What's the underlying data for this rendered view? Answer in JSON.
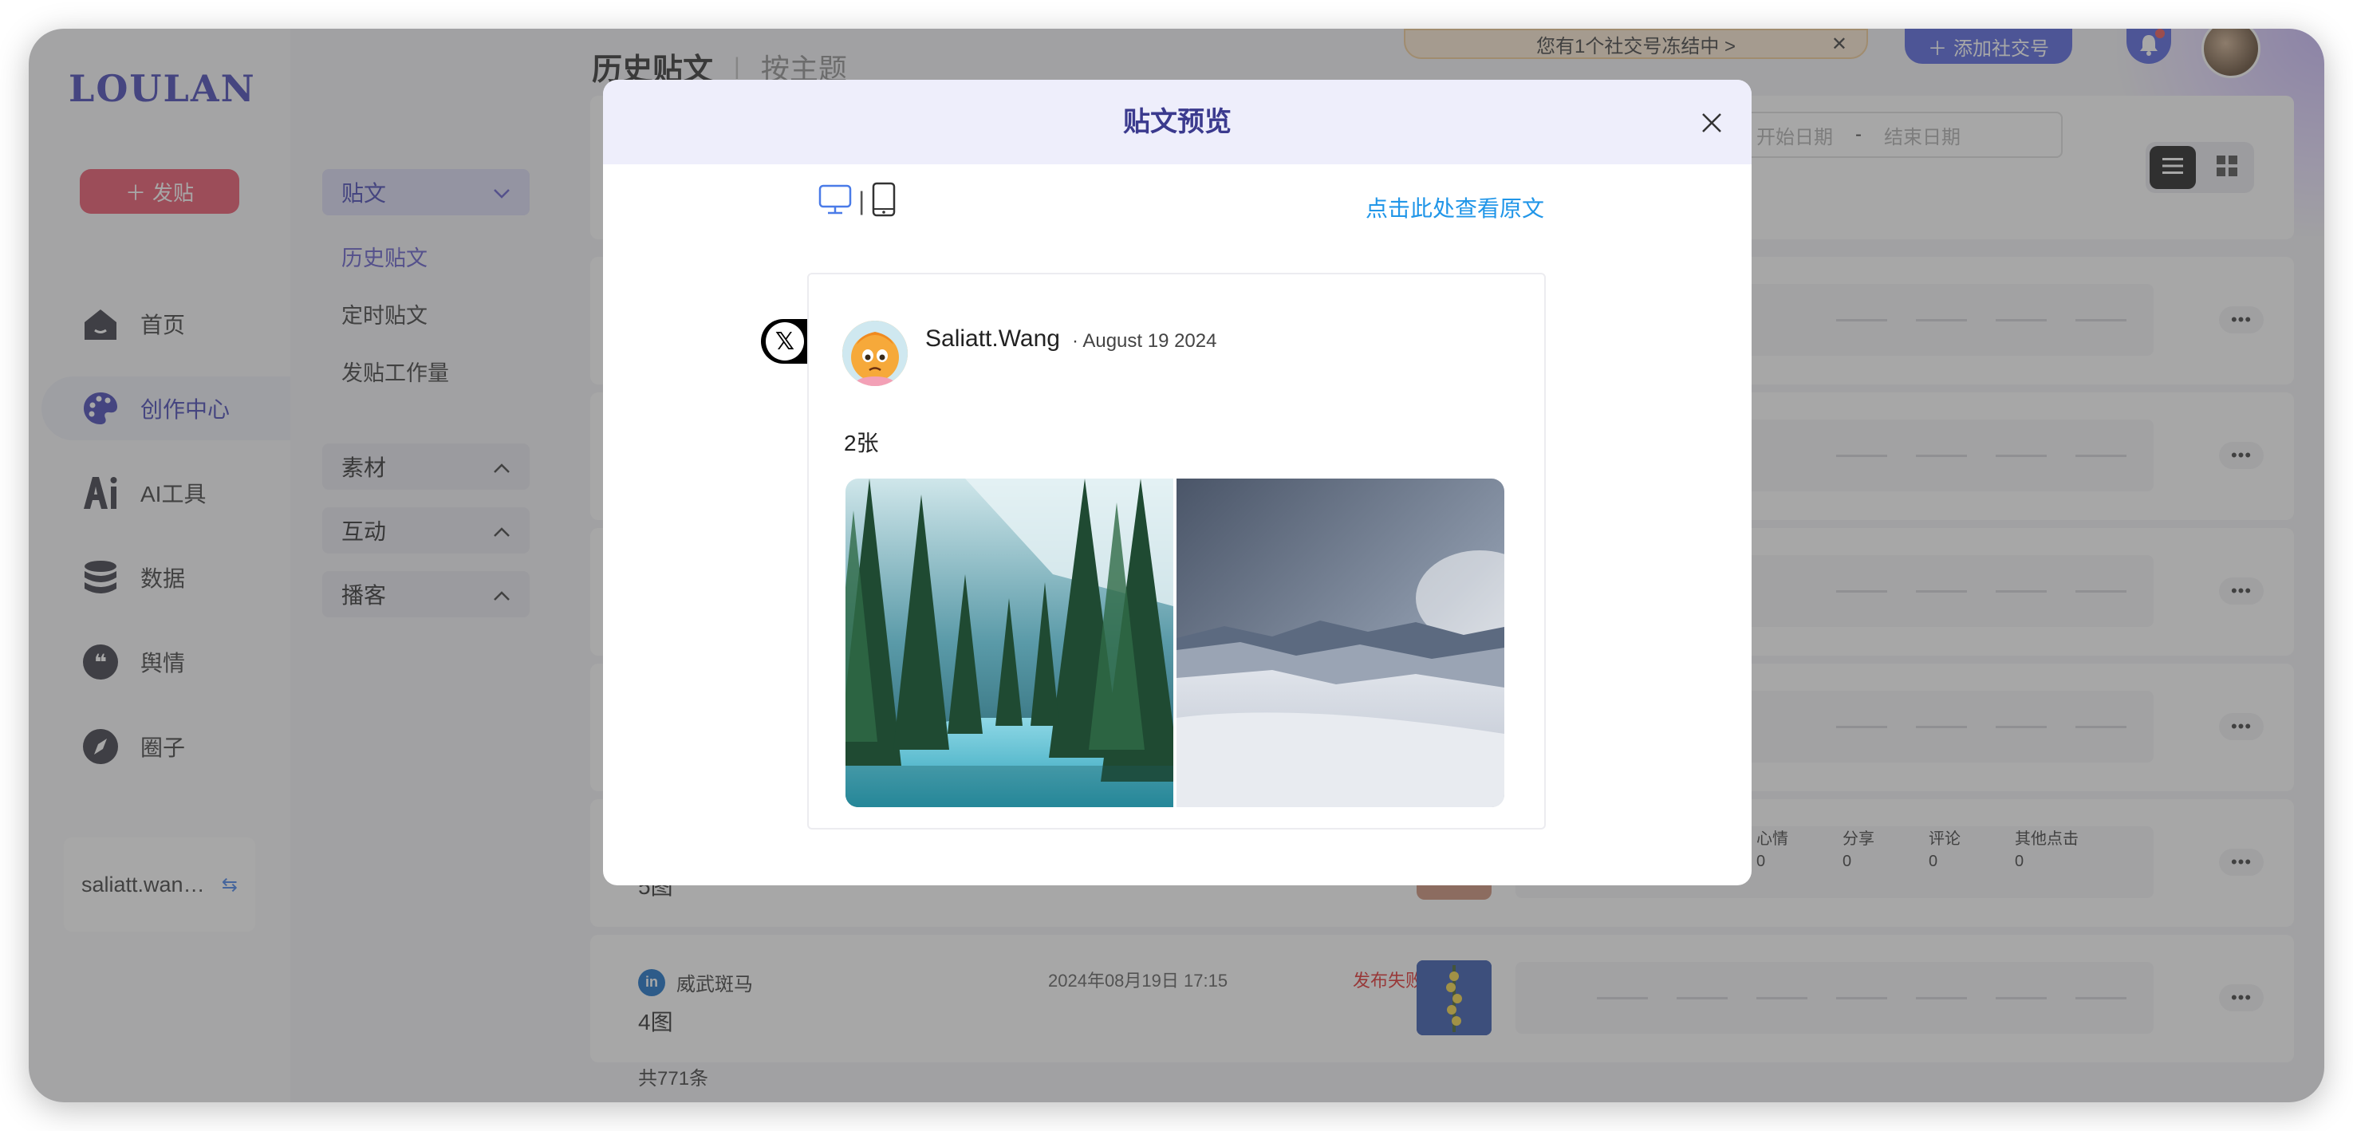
{
  "app": {
    "logo": "LOULAN",
    "publish_label": "发贴"
  },
  "nav": [
    {
      "label": "首页",
      "icon": "home-icon"
    },
    {
      "label": "创作中心",
      "icon": "palette-icon",
      "active": true
    },
    {
      "label": "AI工具",
      "icon": "ai-icon"
    },
    {
      "label": "数据",
      "icon": "database-icon"
    },
    {
      "label": "舆情",
      "icon": "quote-icon"
    },
    {
      "label": "圈子",
      "icon": "compass-icon"
    }
  ],
  "account": {
    "name": "saliatt.wan…",
    "switch_icon": "switch-icon"
  },
  "submenu": {
    "post_header": "贴文",
    "post_items": [
      "历史贴文",
      "定时贴文",
      "发贴工作量"
    ],
    "sections": [
      "素材",
      "互动",
      "播客"
    ]
  },
  "header": {
    "tab_history": "历史贴文",
    "tab_topic": "按主题",
    "notice": "您有1个社交号冻结中 >",
    "add_social": "添加社交号"
  },
  "filters": {
    "start_placeholder": "开始日期",
    "dash": "-",
    "end_placeholder": "结束日期"
  },
  "rows": {
    "row5": {
      "label": "5图",
      "stats": [
        {
          "name": "心情",
          "value": "0"
        },
        {
          "name": "分享",
          "value": "0"
        },
        {
          "name": "评论",
          "value": "0"
        },
        {
          "name": "其他点击",
          "value": "0"
        }
      ]
    },
    "row6": {
      "account": "威武斑马",
      "time": "2024年08月19日 17:15",
      "status": "发布失败 >",
      "title": "4图"
    },
    "more_label": "•••"
  },
  "total": "共771条",
  "modal": {
    "title": "贴文预览",
    "view_original": "点击此处查看原文",
    "divider": "|",
    "post": {
      "author": "Saliatt.Wang",
      "date": "· August 19 2024",
      "text": "2张",
      "platform_badge": "𝕏"
    }
  },
  "colors": {
    "accent": "#3b3bb0",
    "publish": "#e84a63",
    "link": "#2196e8",
    "fail": "#e02020"
  }
}
